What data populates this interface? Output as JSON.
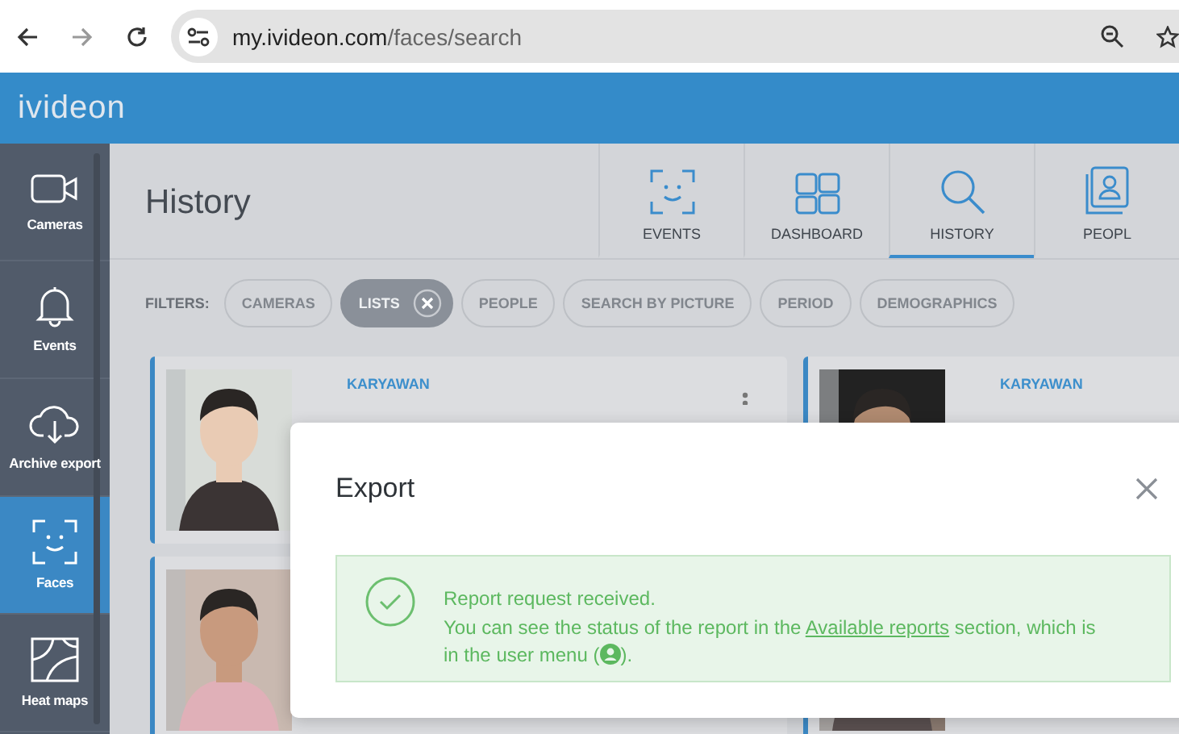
{
  "browser": {
    "url_host": "my.ivideon.com",
    "url_path": "/faces/search"
  },
  "app": {
    "logo": "ivideon"
  },
  "sidebar": {
    "items": [
      {
        "label": "Cameras",
        "kind": "camera",
        "selected": false
      },
      {
        "label": "Events",
        "kind": "bell",
        "selected": false
      },
      {
        "label": "Archive export",
        "kind": "cloud",
        "selected": false
      },
      {
        "label": "Faces",
        "kind": "face",
        "selected": true
      },
      {
        "label": "Heat maps",
        "kind": "heatmap",
        "selected": false
      }
    ]
  },
  "page": {
    "title": "History"
  },
  "tabs": [
    {
      "label": "EVENTS",
      "kind": "face",
      "selected": false
    },
    {
      "label": "DASHBOARD",
      "kind": "grid",
      "selected": false
    },
    {
      "label": "HISTORY",
      "kind": "search",
      "selected": true
    },
    {
      "label": "PEOPL",
      "kind": "person",
      "selected": false
    }
  ],
  "filters": {
    "label": "FILTERS:",
    "chips": [
      {
        "label": "CAMERAS",
        "selected": false
      },
      {
        "label": "LISTS",
        "selected": true
      },
      {
        "label": "PEOPLE",
        "selected": false
      },
      {
        "label": "SEARCH BY PICTURE",
        "selected": false
      },
      {
        "label": "PERIOD",
        "selected": false
      },
      {
        "label": "DEMOGRAPHICS",
        "selected": false
      }
    ]
  },
  "cards": [
    {
      "name": "KARYAWAN",
      "has_menu": true
    },
    {
      "name": "KARYAWAN",
      "has_menu": false
    },
    {
      "has_menu": false
    },
    {
      "has_menu": false
    }
  ],
  "dialog": {
    "title": "Export",
    "message": {
      "line1": "Report request received.",
      "before": "You can see the status of the report in the ",
      "link": "Available reports",
      "after": " section, which is",
      "line3": "in the user menu (",
      "end": ")."
    }
  }
}
